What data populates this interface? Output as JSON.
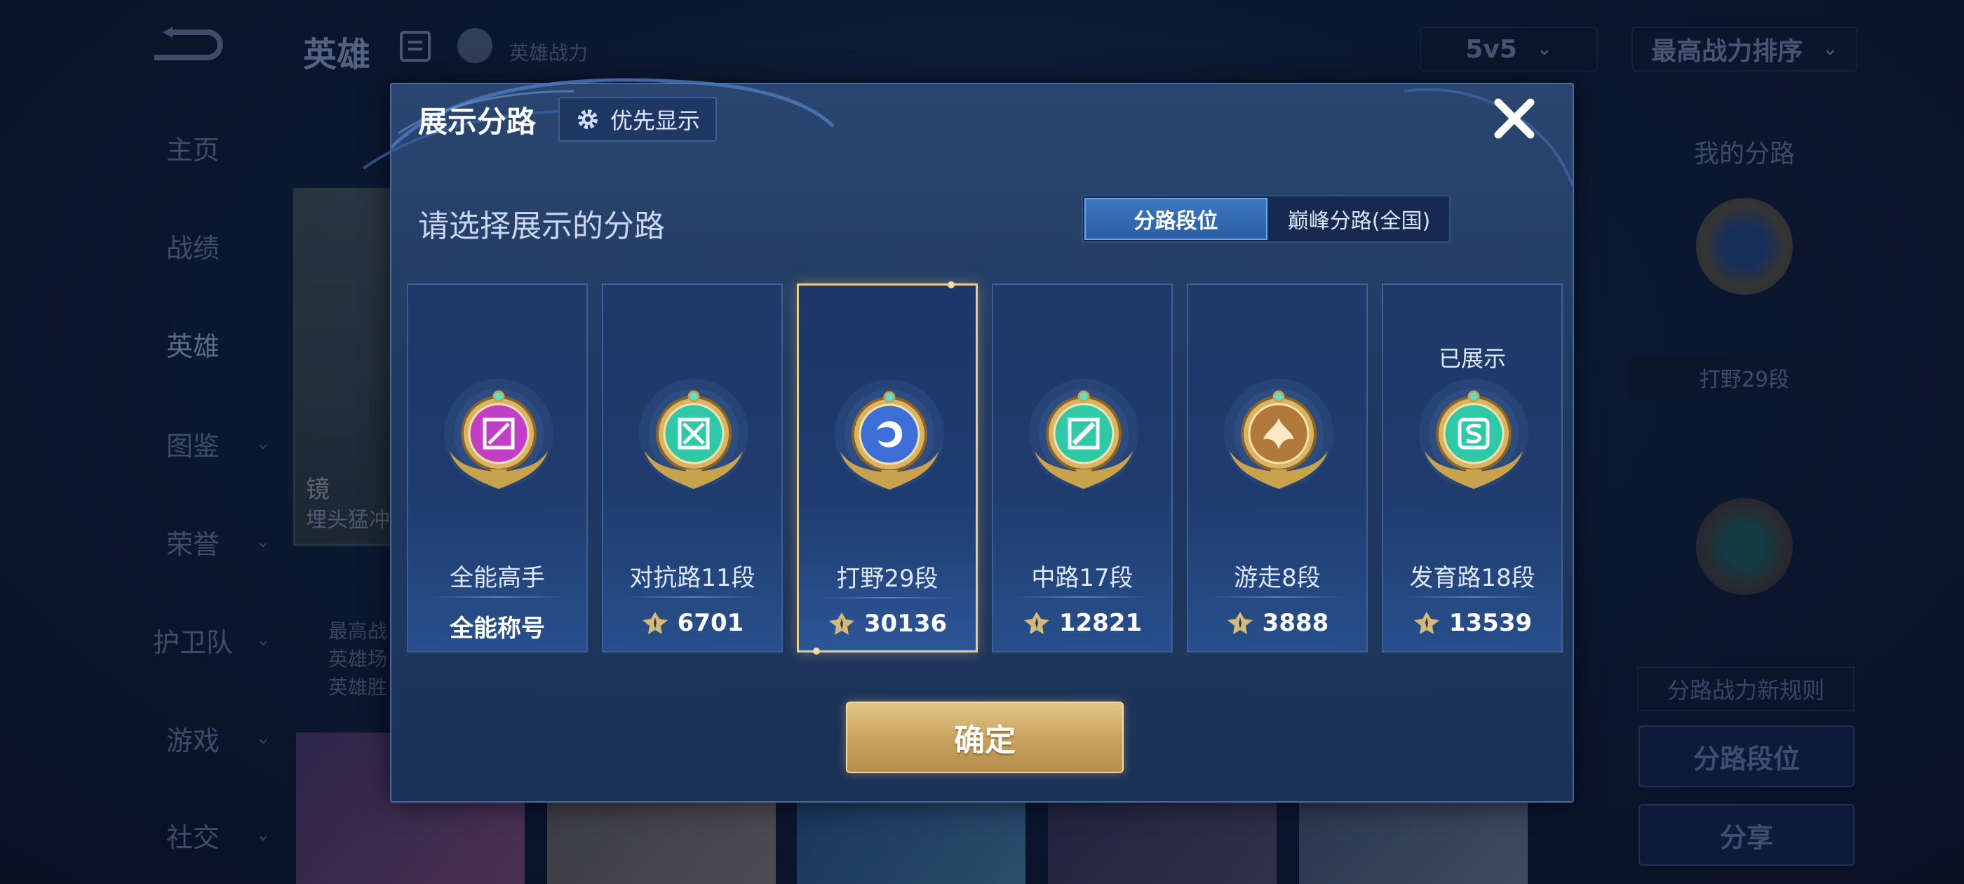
{
  "background": {
    "top_title": "英雄",
    "top_power_label": "英雄战力",
    "mode_select": "5v5",
    "sort_select": "最高战力排序",
    "nav": [
      {
        "label": "主页",
        "has_arrow": false
      },
      {
        "label": "战绩",
        "has_arrow": false
      },
      {
        "label": "英雄",
        "has_arrow": false
      },
      {
        "label": "图鉴",
        "has_arrow": true
      },
      {
        "label": "荣誉",
        "has_arrow": true
      },
      {
        "label": "护卫队",
        "has_arrow": true
      },
      {
        "label": "游戏",
        "has_arrow": true
      },
      {
        "label": "社交",
        "has_arrow": true
      }
    ],
    "hero_name": "镜",
    "hero_sub": "埋头猛冲",
    "hero_info": [
      "最高战",
      "英雄场",
      "英雄胜"
    ],
    "right_title": "我的分路",
    "right_rank": "打野29段",
    "right_rule": "分路战力新规则",
    "right_btn_lane": "分路段位",
    "right_btn_share": "分享"
  },
  "modal": {
    "title": "展示分路",
    "priority_label": "优先显示",
    "subtitle": "请选择展示的分路",
    "tabs": [
      {
        "label": "分路段位",
        "active": true
      },
      {
        "label": "巅峰分路(全国)",
        "active": false
      }
    ],
    "cards": [
      {
        "rank": "全能高手",
        "score": "全能称号",
        "show_power_icon": false,
        "shown": "",
        "emblem": "allround-emblem-icon",
        "color": "#c23ec6",
        "selected": false
      },
      {
        "rank": "对抗路11段",
        "score": "6701",
        "show_power_icon": true,
        "shown": "",
        "emblem": "clash-lane-emblem-icon",
        "color": "#2fc9a8",
        "selected": false
      },
      {
        "rank": "打野29段",
        "score": "30136",
        "show_power_icon": true,
        "shown": "",
        "emblem": "jungle-emblem-icon",
        "color": "#3d6fd8",
        "selected": true
      },
      {
        "rank": "中路17段",
        "score": "12821",
        "show_power_icon": true,
        "shown": "",
        "emblem": "mid-lane-emblem-icon",
        "color": "#2fc9a8",
        "selected": false
      },
      {
        "rank": "游走8段",
        "score": "3888",
        "show_power_icon": true,
        "shown": "",
        "emblem": "roam-emblem-icon",
        "color": "#b27a3a",
        "selected": false
      },
      {
        "rank": "发育路18段",
        "score": "13539",
        "show_power_icon": true,
        "shown": "已展示",
        "emblem": "farm-lane-emblem-icon",
        "color": "#2fc9a8",
        "selected": false
      }
    ],
    "confirm_label": "确定"
  }
}
